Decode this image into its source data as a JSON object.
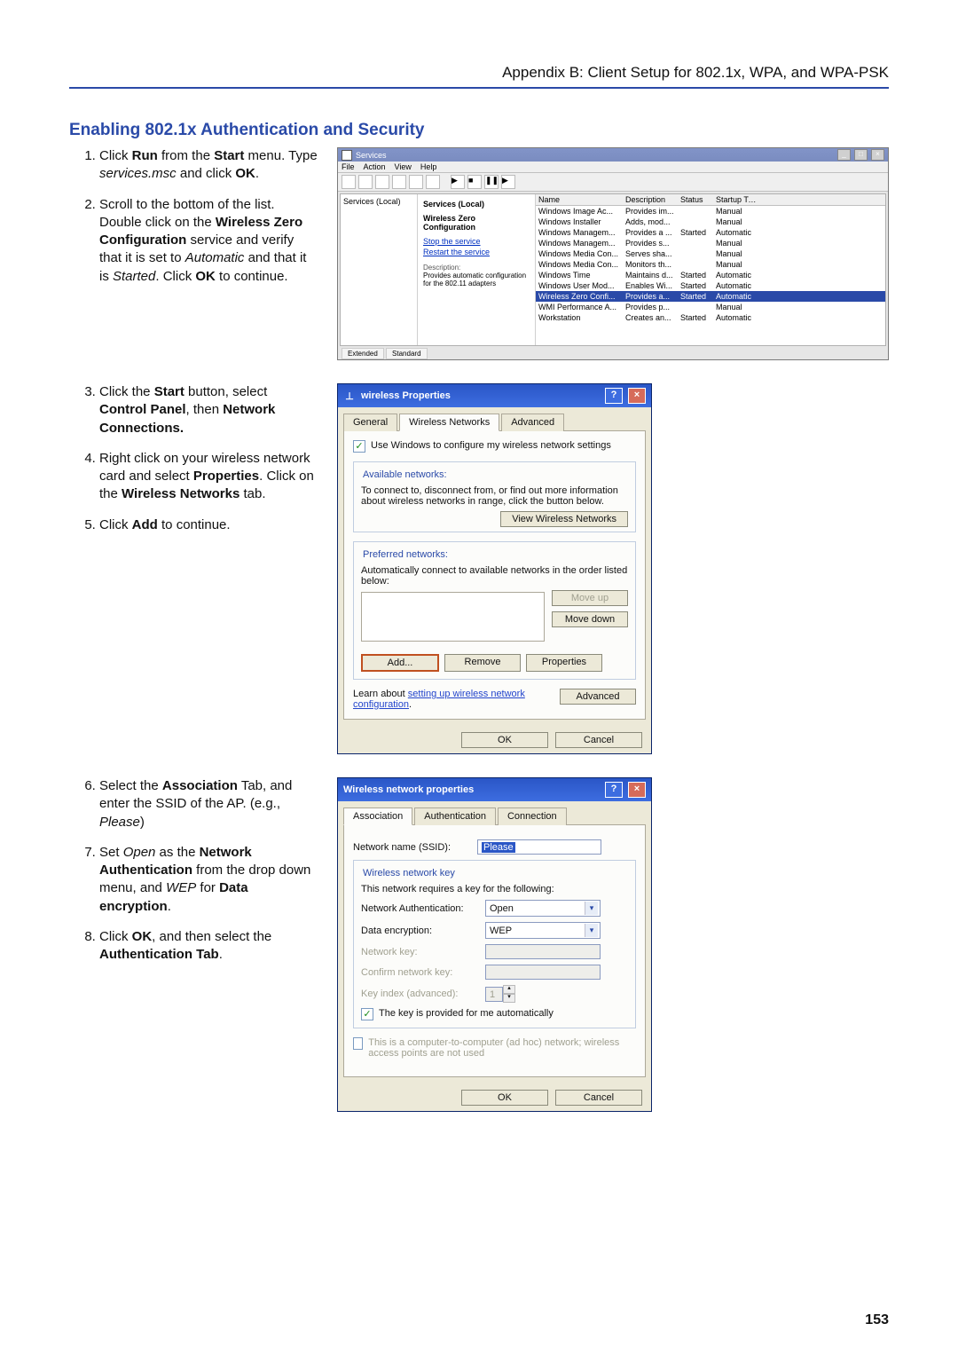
{
  "header": {
    "appendix": "Appendix B: Client Setup for 802.1x, WPA, and WPA-PSK"
  },
  "section_title": "Enabling 802.1x Authentication and Security",
  "steps_a": [
    {
      "pre": "Click ",
      "b1": "Run",
      "mid1": " from the ",
      "b2": "Start",
      "mid2": " menu. Type ",
      "i1": "services.msc",
      "post": " and click ",
      "b3": "OK",
      "end": "."
    },
    {
      "pre": "Scroll to the bottom of the list. Double click on the ",
      "b1": "Wireless Zero Configuration",
      "mid1": " service and verify that it is set to ",
      "i1": "Automatic",
      "mid2": " and that it is ",
      "i2": "Started",
      "post": ". Click ",
      "b2": "OK",
      "end": " to continue."
    }
  ],
  "steps_b": [
    {
      "pre": "Click the ",
      "b1": "Start",
      "mid1": " button, select ",
      "b2": "Control Panel",
      "mid2": ", then ",
      "b3": "Network Connections.",
      "post": ""
    },
    {
      "pre": "Right click on your wireless network card and select ",
      "b1": "Properties",
      "mid1": ". Click on the ",
      "b2": "Wireless Networks",
      "post": " tab."
    },
    {
      "pre": "Click ",
      "b1": "Add",
      "post": " to continue."
    }
  ],
  "steps_c": [
    {
      "pre": "Select the ",
      "b1": "Association",
      "mid1": " Tab, and enter the SSID of the AP. (e.g., ",
      "i1": "Please",
      "post": ")"
    },
    {
      "pre": "Set ",
      "i1": "Open",
      "mid1": " as the ",
      "b1": "Network Authentication",
      "mid2": " from the drop down menu, and ",
      "i2": "WEP",
      "mid3": " for ",
      "b2": "Data encryption",
      "post": "."
    },
    {
      "pre": "Click ",
      "b1": "OK",
      "mid1": ", and then select the ",
      "b2": "Authentication Tab",
      "post": "."
    }
  ],
  "services_window": {
    "title": "Services",
    "menu": [
      "File",
      "Action",
      "View",
      "Help"
    ],
    "tree_root": "Services (Local)",
    "mid_title": "Services (Local)",
    "selected_name": "Wireless Zero Configuration",
    "link_stop": "Stop the service",
    "link_restart": "Restart the service",
    "desc_label": "Description:",
    "desc_text": "Provides automatic configuration for the 802.11 adapters",
    "columns": [
      "Name",
      "Description",
      "Status",
      "Startup Type"
    ],
    "rows": [
      [
        "Windows Image Ac...",
        "Provides im...",
        "",
        "Manual"
      ],
      [
        "Windows Installer",
        "Adds, mod...",
        "",
        "Manual"
      ],
      [
        "Windows Managem...",
        "Provides a ...",
        "Started",
        "Automatic"
      ],
      [
        "Windows Managem...",
        "Provides s...",
        "",
        "Manual"
      ],
      [
        "Windows Media Con...",
        "Serves sha...",
        "",
        "Manual"
      ],
      [
        "Windows Media Con...",
        "Monitors th...",
        "",
        "Manual"
      ],
      [
        "Windows Time",
        "Maintains d...",
        "Started",
        "Automatic"
      ],
      [
        "Windows User Mod...",
        "Enables Wi...",
        "Started",
        "Automatic"
      ],
      [
        "Wireless Zero Confi...",
        "Provides a...",
        "Started",
        "Automatic"
      ],
      [
        "WMI Performance A...",
        "Provides p...",
        "",
        "Manual"
      ],
      [
        "Workstation",
        "Creates an...",
        "Started",
        "Automatic"
      ]
    ],
    "tabs": [
      "Extended",
      "Standard"
    ]
  },
  "wireless_props": {
    "title": "wireless Properties",
    "tabs": [
      "General",
      "Wireless Networks",
      "Advanced"
    ],
    "use_windows": "Use Windows to configure my wireless network settings",
    "group_available": "Available networks:",
    "available_text": "To connect to, disconnect from, or find out more information about wireless networks in range, click the button below.",
    "btn_view": "View Wireless Networks",
    "group_preferred": "Preferred networks:",
    "preferred_text": "Automatically connect to available networks in the order listed below:",
    "btn_moveup": "Move up",
    "btn_movedown": "Move down",
    "btn_add": "Add...",
    "btn_remove": "Remove",
    "btn_props": "Properties",
    "learn_pre": "Learn about ",
    "learn_link": "setting up wireless network configuration",
    "learn_post": ".",
    "btn_advanced": "Advanced",
    "btn_ok": "OK",
    "btn_cancel": "Cancel"
  },
  "net_props": {
    "title": "Wireless network properties",
    "tabs": [
      "Association",
      "Authentication",
      "Connection"
    ],
    "ssid_label": "Network name (SSID):",
    "ssid_value": "Please",
    "group_key": "Wireless network key",
    "key_text": "This network requires a key for the following:",
    "lbl_auth": "Network Authentication:",
    "val_auth": "Open",
    "lbl_enc": "Data encryption:",
    "val_enc": "WEP",
    "lbl_netkey": "Network key:",
    "lbl_confirm": "Confirm network key:",
    "lbl_keyidx": "Key index (advanced):",
    "keyidx_val": "1",
    "chk_auto": "The key is provided for me automatically",
    "chk_adhoc": "This is a computer-to-computer (ad hoc) network; wireless access points are not used",
    "btn_ok": "OK",
    "btn_cancel": "Cancel"
  },
  "page_number": "153"
}
